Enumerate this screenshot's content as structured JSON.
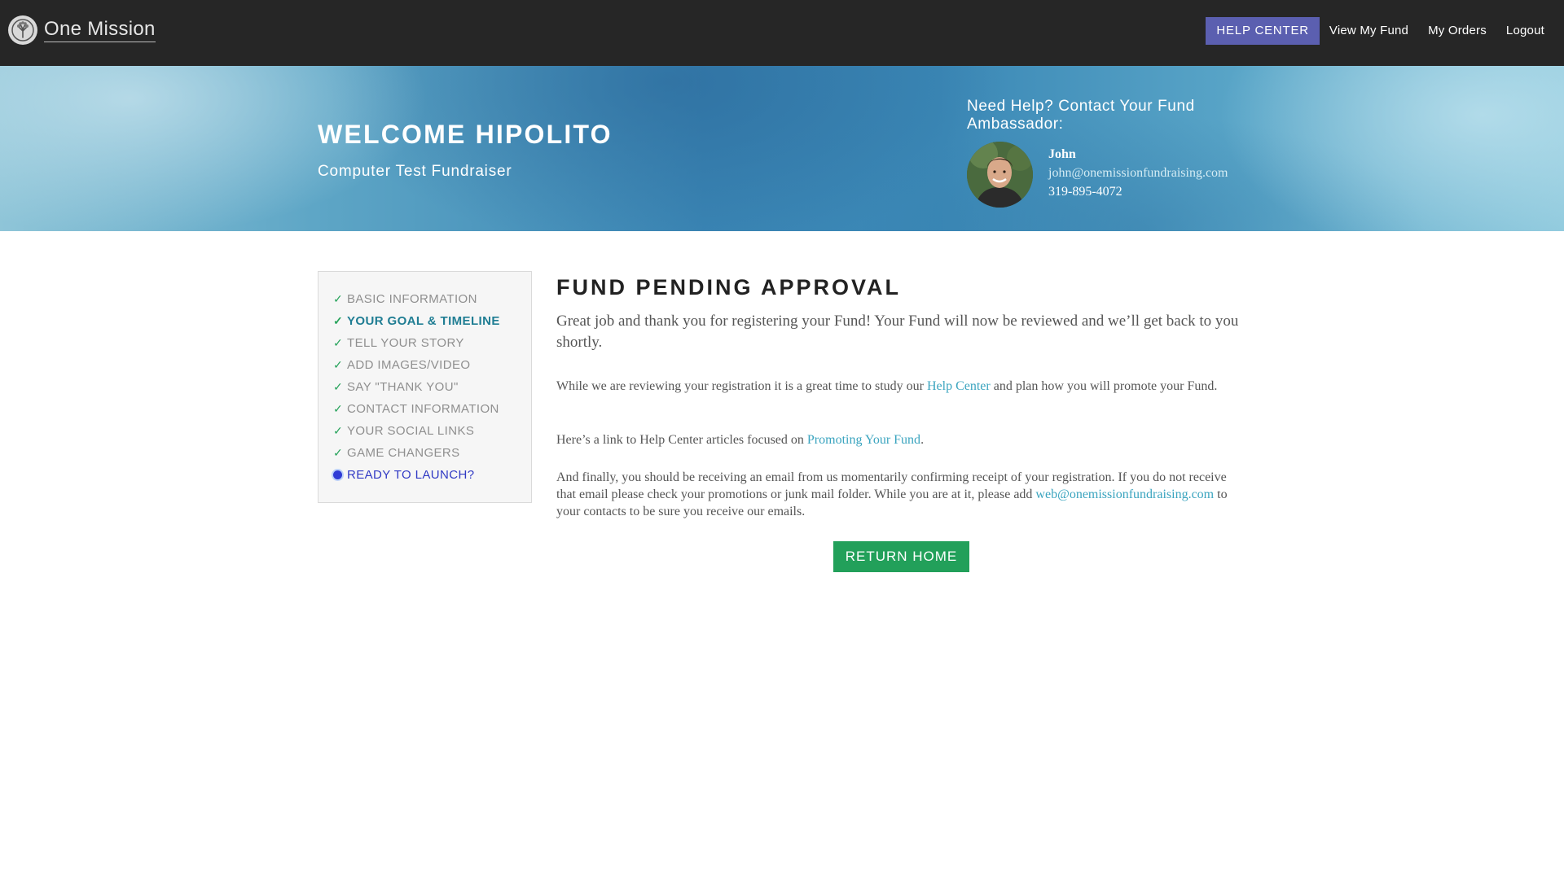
{
  "brand": {
    "name": "One Mission"
  },
  "nav": {
    "help_center": "HELP CENTER",
    "view_my_fund": "View My Fund",
    "my_orders": "My Orders",
    "logout": "Logout"
  },
  "hero": {
    "welcome": "WELCOME HIPOLITO",
    "fund_name": "Computer Test Fundraiser",
    "help_heading": "Need Help? Contact Your Fund Ambassador:",
    "ambassador": {
      "name": "John",
      "email": "john@onemissionfundraising.com",
      "phone": "319-895-4072"
    }
  },
  "sidebar": {
    "steps": [
      {
        "label": "BASIC INFORMATION",
        "state": "done"
      },
      {
        "label": "YOUR GOAL & TIMELINE",
        "state": "active"
      },
      {
        "label": "TELL YOUR STORY",
        "state": "done"
      },
      {
        "label": "ADD IMAGES/VIDEO",
        "state": "done"
      },
      {
        "label": "SAY \"THANK YOU\"",
        "state": "done"
      },
      {
        "label": "CONTACT INFORMATION",
        "state": "done"
      },
      {
        "label": "YOUR SOCIAL LINKS",
        "state": "done"
      },
      {
        "label": "GAME CHANGERS",
        "state": "done"
      },
      {
        "label": "READY TO LAUNCH?",
        "state": "current"
      }
    ],
    "check_glyph": "✓"
  },
  "main": {
    "title": "FUND PENDING APPROVAL",
    "lead": "Great job and thank you for registering your Fund! Your Fund will now be reviewed and we’ll get back to you shortly.",
    "p1_before": "While we are reviewing your registration it is a great time to study our ",
    "p1_link": "Help Center",
    "p1_after": " and plan how you will promote your Fund.",
    "p2_before": "Here’s a link to Help Center articles focused on ",
    "p2_link": "Promoting Your Fund",
    "p2_after": ".",
    "p3_before": "And finally, you should be receiving an email from us momentarily confirming receipt of your registration. If you do not receive that email please check your promotions or junk mail folder. While you are at it, please add ",
    "p3_link": "web@onemissionfundraising.com",
    "p3_after": " to your contacts to be sure you receive our emails.",
    "return_home": "RETURN HOME"
  },
  "colors": {
    "topbar": "#262626",
    "help_button": "#5b5fb0",
    "link": "#3aa4bf",
    "return_button": "#22a05a",
    "active_step": "#1f7d93",
    "current_step": "#3039c4"
  }
}
